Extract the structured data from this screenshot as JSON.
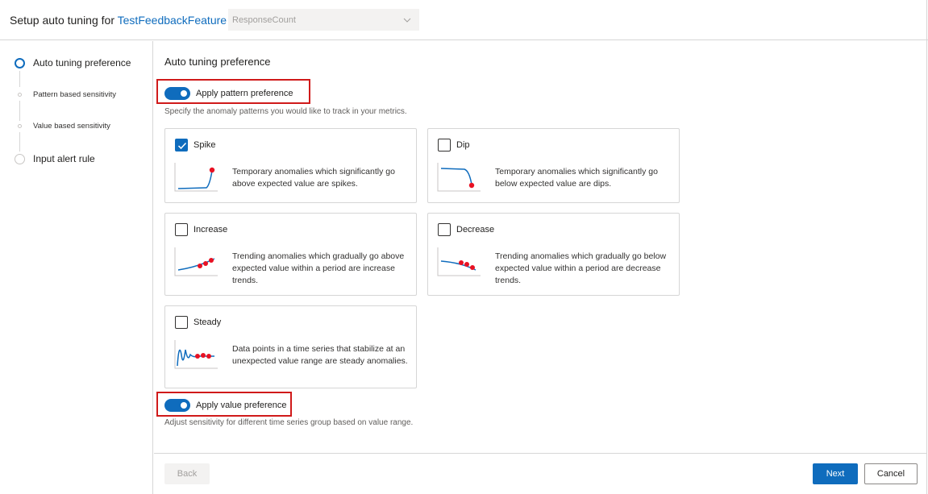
{
  "header": {
    "title_prefix": "Setup auto tuning for",
    "feature_link": "TestFeedbackFeature",
    "separator": "/",
    "metric_select": {
      "value": "ResponseCount",
      "chevron_icon": "chevron-down-icon"
    }
  },
  "steps": [
    {
      "label": "Auto tuning preference",
      "state": "current"
    },
    {
      "label": "Pattern based sensitivity",
      "state": "sub"
    },
    {
      "label": "Value based sensitivity",
      "state": "sub"
    },
    {
      "label": "Input alert rule",
      "state": "pending"
    }
  ],
  "main": {
    "title": "Auto tuning preference",
    "pattern_toggle": {
      "label": "Apply pattern preference",
      "on": true
    },
    "pattern_description": "Specify the anomaly patterns you would like to track in your metrics.",
    "patterns": [
      {
        "name": "Spike",
        "checked": true,
        "description": "Temporary anomalies which significantly go above expected value are spikes.",
        "icon": "spike-chart-icon"
      },
      {
        "name": "Dip",
        "checked": false,
        "description": "Temporary anomalies which significantly go below expected value are dips.",
        "icon": "dip-chart-icon"
      },
      {
        "name": "Increase",
        "checked": false,
        "description": "Trending anomalies which gradually go above expected value within a period are increase trends.",
        "icon": "increase-chart-icon"
      },
      {
        "name": "Decrease",
        "checked": false,
        "description": "Trending anomalies which gradually go below expected value within a period are decrease trends.",
        "icon": "decrease-chart-icon"
      },
      {
        "name": "Steady",
        "checked": false,
        "description": "Data points in a time series that stabilize at an unexpected value range are steady anomalies.",
        "icon": "steady-chart-icon"
      }
    ],
    "value_toggle": {
      "label": "Apply value preference",
      "on": true
    },
    "value_description": "Adjust sensitivity for different time series group based on value range."
  },
  "footer": {
    "back_label": "Back",
    "next_label": "Next",
    "cancel_label": "Cancel"
  },
  "colors": {
    "accent": "#0f6cbd",
    "highlight_box": "#d01a1a",
    "anomaly_point": "#e81123"
  }
}
